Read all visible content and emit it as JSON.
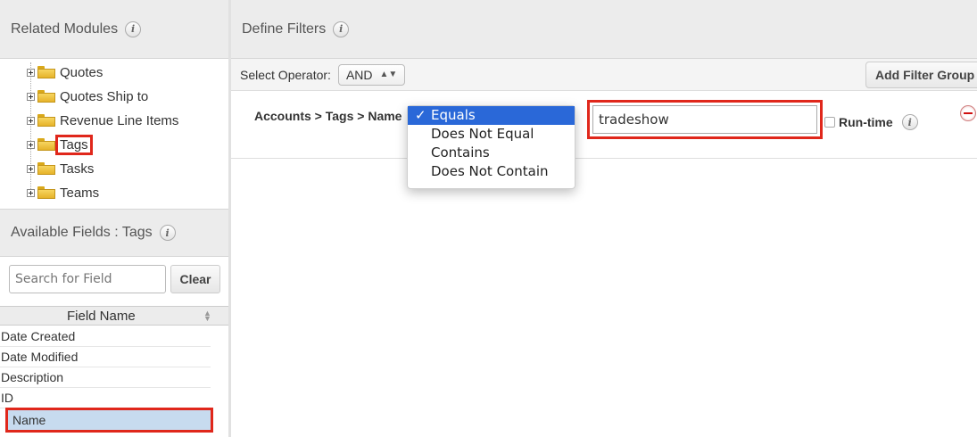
{
  "related_modules": {
    "title": "Related Modules",
    "items": [
      {
        "label": "Quotes",
        "selected": false
      },
      {
        "label": "Quotes Ship to",
        "selected": false
      },
      {
        "label": "Revenue Line Items",
        "selected": false
      },
      {
        "label": "Tags",
        "selected": true
      },
      {
        "label": "Tasks",
        "selected": false
      },
      {
        "label": "Teams",
        "selected": false
      }
    ]
  },
  "available_fields": {
    "title": "Available Fields : Tags",
    "search_placeholder": "Search for Field",
    "clear_label": "Clear",
    "column_header": "Field Name",
    "fields": [
      {
        "label": "Date Created",
        "selected": false
      },
      {
        "label": "Date Modified",
        "selected": false
      },
      {
        "label": "Description",
        "selected": false
      },
      {
        "label": "ID",
        "selected": false
      },
      {
        "label": "Name",
        "selected": true
      }
    ]
  },
  "define_filters": {
    "title": "Define Filters",
    "operator_label": "Select Operator:",
    "operator_value": "AND",
    "add_group_label": "Add Filter Group",
    "filter": {
      "field_path": "Accounts > Tags > Name",
      "value": "tradeshow",
      "runtime_label": "Run-time",
      "runtime_checked": false
    },
    "operator_menu": {
      "options": [
        "Equals",
        "Does Not Equal",
        "Contains",
        "Does Not Contain"
      ],
      "selected_index": 0,
      "check_mark": "✓"
    }
  },
  "icons": {
    "info": "i"
  },
  "colors": {
    "highlight_border": "#e0271b",
    "selected_row_bg": "#c7dbef",
    "menu_active_bg": "#2a68d8",
    "header_bg": "#ececec"
  }
}
